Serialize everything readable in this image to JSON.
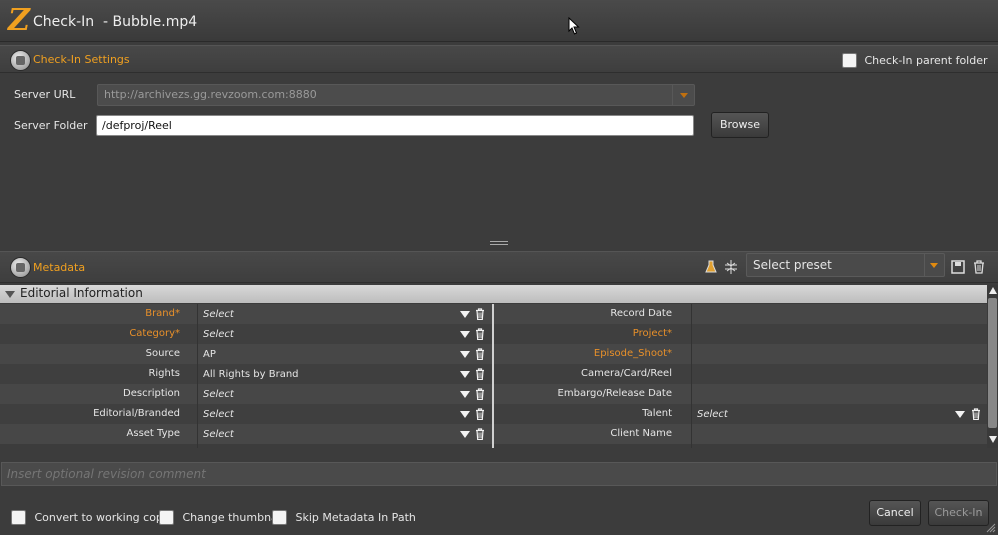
{
  "window": {
    "app_logo": "Z",
    "title": "Check-In  - Bubble.mp4"
  },
  "checkin_settings": {
    "header": "Check-In Settings",
    "parent_folder_label": "Check-In parent folder",
    "server_url_label": "Server URL",
    "server_url_value": "http://archivezs.gg.revzoom.com:8880",
    "server_folder_label": "Server Folder",
    "server_folder_value": "/defproj/Reel",
    "browse_label": "Browse"
  },
  "metadata": {
    "header": "Metadata",
    "preset_label": "Select preset",
    "group_title": "Editorial Information",
    "left_rows": [
      {
        "label": "Brand*",
        "required": true,
        "value": "Select",
        "placeholder": true
      },
      {
        "label": "Category*",
        "required": true,
        "value": "Select",
        "placeholder": true
      },
      {
        "label": "Source",
        "required": false,
        "value": "AP",
        "placeholder": false
      },
      {
        "label": "Rights",
        "required": false,
        "value": "All Rights by Brand",
        "placeholder": false
      },
      {
        "label": "Description",
        "required": false,
        "value": "Select",
        "placeholder": true
      },
      {
        "label": "Editorial/Branded",
        "required": false,
        "value": "Select",
        "placeholder": true
      },
      {
        "label": "Asset Type",
        "required": false,
        "value": "Select",
        "placeholder": true
      }
    ],
    "right_rows": [
      {
        "label": "Record Date",
        "required": false,
        "value": ""
      },
      {
        "label": "Project*",
        "required": true,
        "value": ""
      },
      {
        "label": "Episode_Shoot*",
        "required": true,
        "value": ""
      },
      {
        "label": "Camera/Card/Reel",
        "required": false,
        "value": ""
      },
      {
        "label": "Embargo/Release Date",
        "required": false,
        "value": ""
      },
      {
        "label": "Talent",
        "required": false,
        "value": "Select",
        "has_dropdown": true
      },
      {
        "label": "Client Name",
        "required": false,
        "value": ""
      }
    ]
  },
  "comment": {
    "placeholder": "Insert optional revision comment"
  },
  "footer": {
    "convert_label": "Convert to working copy",
    "thumbnail_label": "Change thumbnail",
    "skip_metadata_label": "Skip Metadata In Path",
    "cancel_label": "Cancel",
    "checkin_label": "Check-In"
  },
  "colors": {
    "accent": "#f0a020",
    "required_label": "#e8902a",
    "background": "#3c3c3c"
  }
}
